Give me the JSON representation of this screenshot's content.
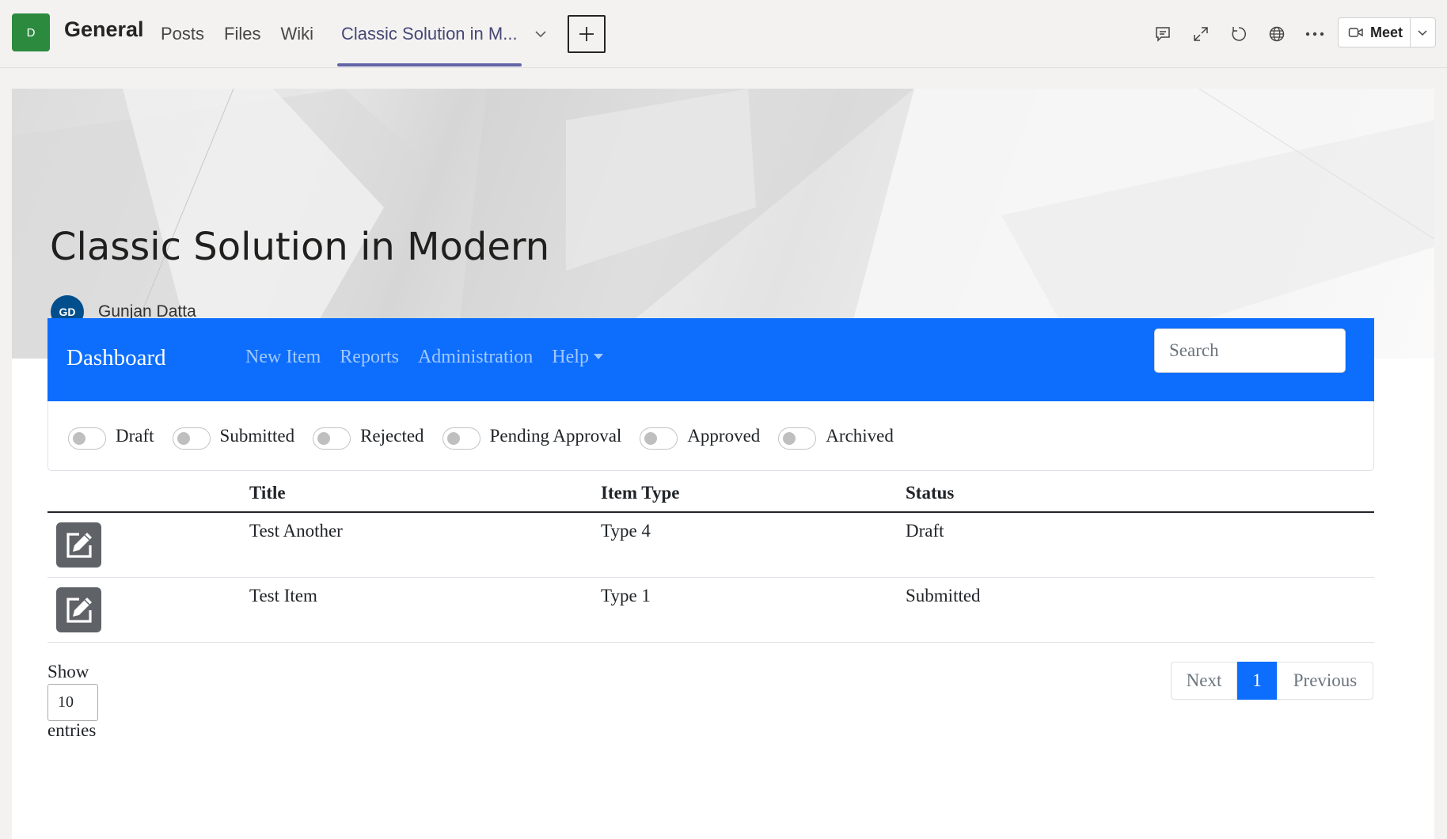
{
  "teams": {
    "team_initial": "D",
    "channel": "General",
    "tabs": [
      "Posts",
      "Files",
      "Wiki"
    ],
    "active_tab": "Classic Solution in M...",
    "meet_label": "Meet",
    "icons": [
      "chat-icon",
      "expand-icon",
      "refresh-icon",
      "globe-icon",
      "more-icon",
      "video-icon",
      "chevron-down-icon"
    ]
  },
  "hero": {
    "title": "Classic Solution in Modern",
    "author_initials": "GD",
    "author_name": "Gunjan Datta"
  },
  "navbar": {
    "brand": "Dashboard",
    "links": [
      "New Item",
      "Reports",
      "Administration"
    ],
    "help": "Help",
    "search_placeholder": "Search",
    "color": "#0d6efd"
  },
  "filters": [
    "Draft",
    "Submitted",
    "Rejected",
    "Pending Approval",
    "Approved",
    "Archived"
  ],
  "table": {
    "columns": [
      "Title",
      "Item Type",
      "Status"
    ],
    "rows": [
      {
        "title": "Test Another",
        "type": "Type 4",
        "status": "Draft"
      },
      {
        "title": "Test Item",
        "type": "Type 1",
        "status": "Submitted"
      }
    ]
  },
  "paging": {
    "show": "Show",
    "page_size": "10",
    "entries": "entries",
    "next": "Next",
    "current": "1",
    "previous": "Previous"
  }
}
